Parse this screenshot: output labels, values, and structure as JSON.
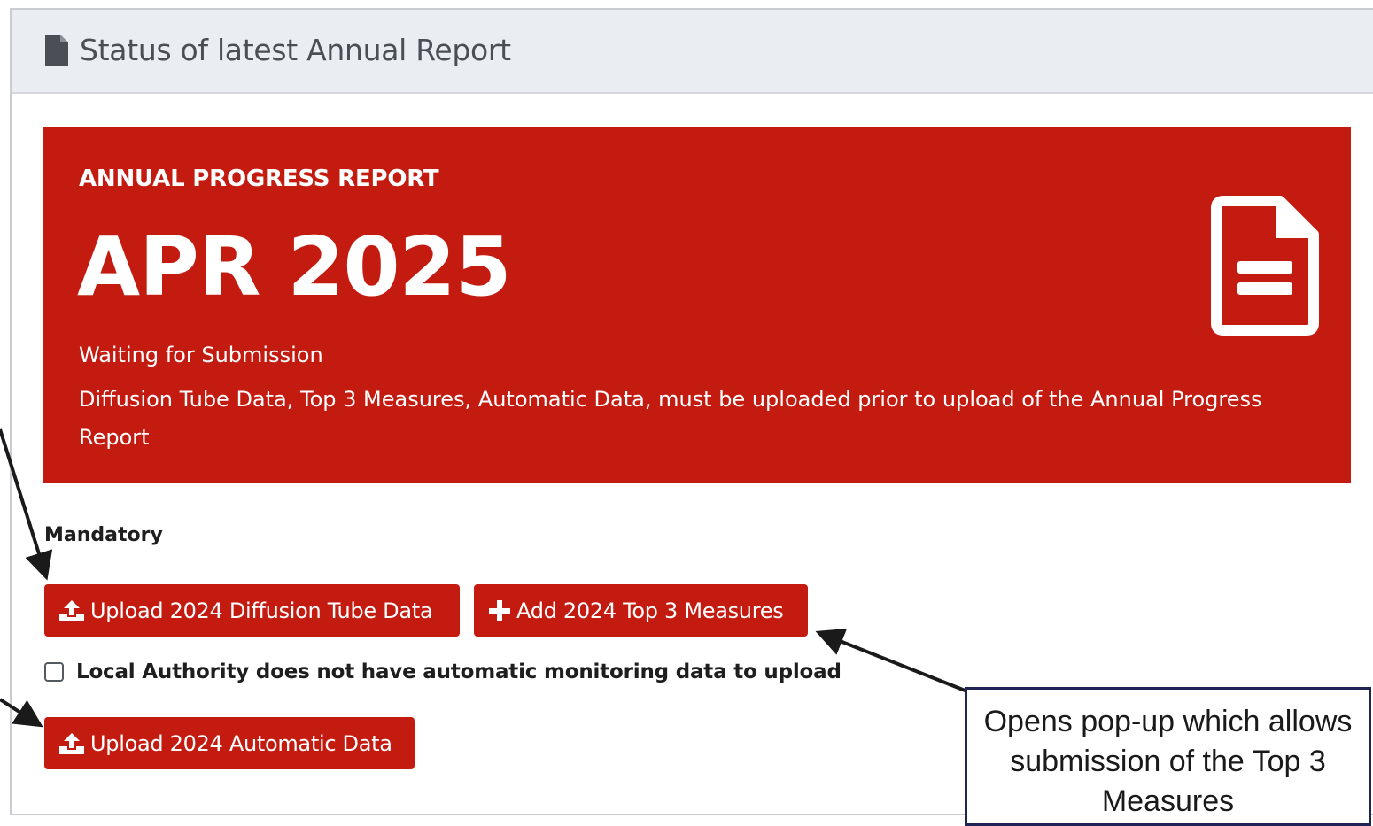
{
  "header": {
    "title": "Status of latest Annual Report",
    "icon": "file-icon"
  },
  "banner": {
    "label": "ANNUAL PROGRESS REPORT",
    "heading": "APR 2025",
    "status": "Waiting for Submission",
    "note": "Diffusion Tube Data, Top 3 Measures, Automatic Data, must be uploaded prior to upload of the Annual Progress Report",
    "background_color": "#c41b11",
    "icon": "file-text-icon"
  },
  "mandatory": {
    "label": "Mandatory"
  },
  "actions": {
    "upload_diffusion": "Upload 2024 Diffusion Tube Data",
    "add_top3": "Add 2024 Top 3 Measures",
    "no_automatic_checkbox": "Local Authority does not have automatic monitoring data to upload",
    "no_automatic_checked": false,
    "upload_automatic": "Upload 2024 Automatic Data",
    "button_color": "#c41b11"
  },
  "annotation": {
    "callout": "Opens pop-up which allows submission of the Top 3 Measures",
    "border_color": "#1f2356"
  }
}
